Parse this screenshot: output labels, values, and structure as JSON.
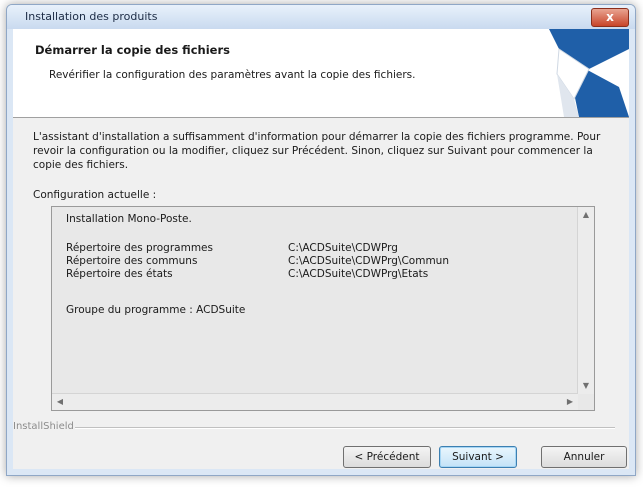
{
  "window": {
    "title": "Installation des produits",
    "close_label": "x"
  },
  "header": {
    "title": "Démarrer la copie des fichiers",
    "subtitle": "Revérifier la configuration des paramètres avant la copie des fichiers."
  },
  "intro": "L'assistant d'installation a suffisamment d'information pour démarrer la copie des fichiers programme. Pour revoir la configuration ou la modifier, cliquez sur Précédent. Sinon, cliquez sur Suivant pour commencer la copie des fichiers.",
  "config": {
    "label": "Configuration actuelle :",
    "mode": "Installation Mono-Poste.",
    "directories": [
      {
        "name": "Répertoire des programmes",
        "path": "C:\\ACDSuite\\CDWPrg"
      },
      {
        "name": "Répertoire des communs",
        "path": "C:\\ACDSuite\\CDWPrg\\Commun"
      },
      {
        "name": "Répertoire des états",
        "path": "C:\\ACDSuite\\CDWPrg\\Etats"
      }
    ],
    "group": "Groupe du programme : ACDSuite"
  },
  "footer": {
    "brand": "InstallShield"
  },
  "buttons": {
    "back": "< Précédent",
    "next": "Suivant >",
    "cancel": "Annuler"
  },
  "colors": {
    "accent": "#1f5fa8",
    "default_button_border": "#3c7fb1"
  }
}
